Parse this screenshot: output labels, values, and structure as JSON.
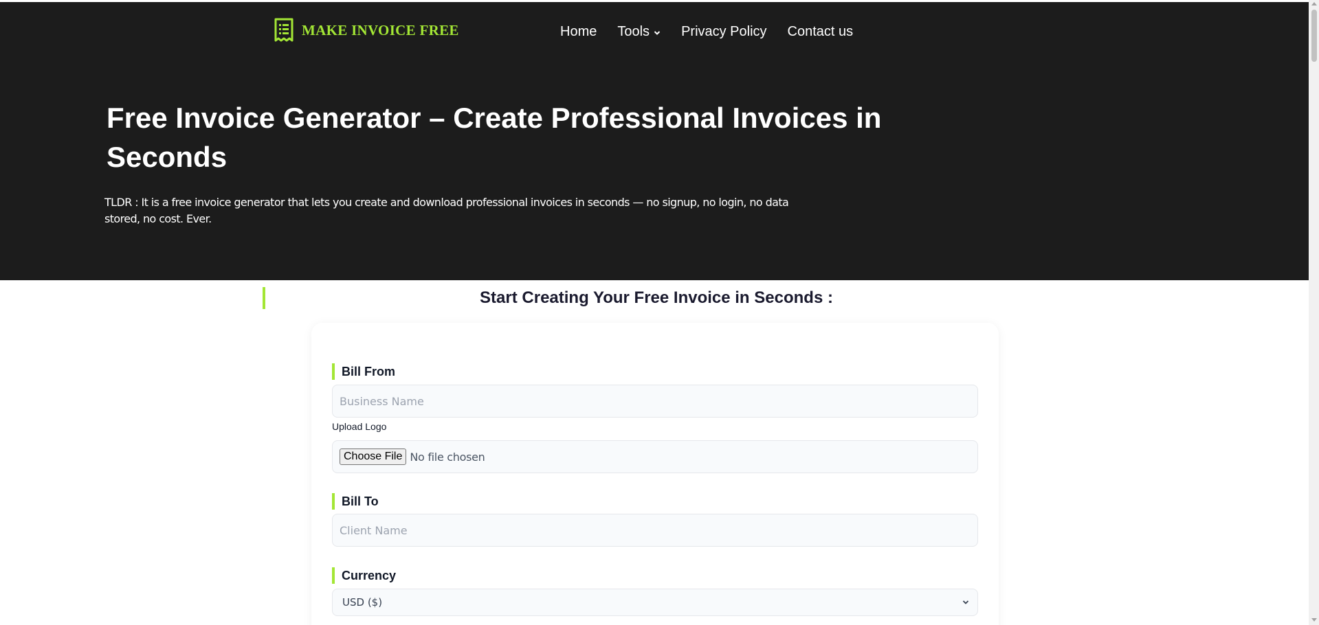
{
  "brand": {
    "logo_text": "MAKE INVOICE FREE",
    "accent_color": "#a3e635",
    "logo_icon": "receipt-icon"
  },
  "nav": {
    "home": "Home",
    "tools": "Tools",
    "privacy": "Privacy Policy",
    "contact": "Contact us"
  },
  "hero": {
    "title": "Free Invoice Generator – Create Professional Invoices in Seconds",
    "tldr": "TLDR : It is a free invoice generator that lets you create and download professional invoices in seconds — no signup, no login, no data stored, no cost. Ever.",
    "background_color": "#1c1c1c"
  },
  "section": {
    "title": "Start Creating Your Free Invoice in Seconds :"
  },
  "form": {
    "bill_from": {
      "label": "Bill From",
      "business_placeholder": "Business Name",
      "upload_label": "Upload Logo",
      "choose_file": "Choose File",
      "file_status": "No file chosen"
    },
    "bill_to": {
      "label": "Bill To",
      "client_placeholder": "Client Name"
    },
    "currency": {
      "label": "Currency",
      "selected": "USD ($)"
    }
  }
}
